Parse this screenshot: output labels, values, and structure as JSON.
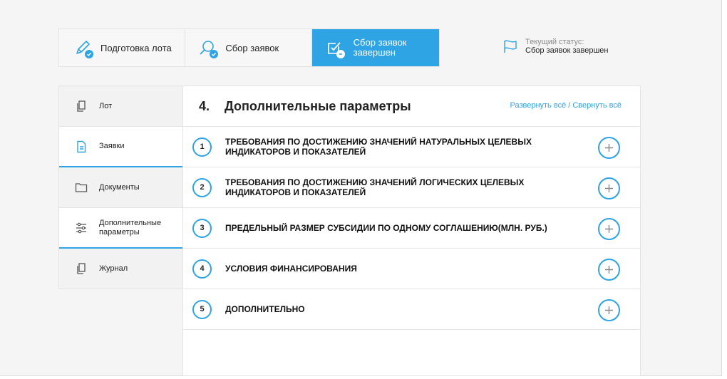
{
  "stepper": {
    "steps": [
      {
        "label": "Подготовка лота",
        "icon": "pencil-icon",
        "badge": "check-badge"
      },
      {
        "label": "Сбор заявок",
        "icon": "search-icon",
        "badge": "check-badge"
      },
      {
        "label_line1": "Сбор заявок",
        "label_line2": "завершен",
        "icon": "checkbox-icon",
        "badge": "minus-badge",
        "active": true
      }
    ]
  },
  "status": {
    "caption": "Текущий статус:",
    "value": "Сбор заявок завершен",
    "icon": "flag-icon"
  },
  "sidebar": {
    "items": [
      {
        "label": "Лот",
        "icon": "copy-icon"
      },
      {
        "label": "Заявки",
        "icon": "document-icon",
        "active": true
      },
      {
        "label": "Документы",
        "icon": "folder-icon"
      },
      {
        "label_line1": "Дополнительные",
        "label_line2": "параметры",
        "icon": "sliders-icon",
        "active": true
      },
      {
        "label": "Журнал",
        "icon": "copy-icon"
      }
    ]
  },
  "main": {
    "section_number": "4.",
    "title": "Дополнительные параметры",
    "expand_collapse": "Развернуть всё / Свернуть всё",
    "rows": [
      {
        "num": "1",
        "title_line1": "ТРЕБОВАНИЯ ПО ДОСТИЖЕНИЮ ЗНАЧЕНИЙ НАТУРАЛЬНЫХ ЦЕЛЕВЫХ",
        "title_line2": "ИНДИКАТОРОВ И ПОКАЗАТЕЛЕЙ"
      },
      {
        "num": "2",
        "title_line1": "ТРЕБОВАНИЯ ПО ДОСТИЖЕНИЮ ЗНАЧЕНИЙ ЛОГИЧЕСКИХ ЦЕЛЕВЫХ",
        "title_line2": "ИНДИКАТОРОВ И ПОКАЗАТЕЛЕЙ"
      },
      {
        "num": "3",
        "title_line1": "ПРЕДЕЛЬНЫЙ РАЗМЕР СУБСИДИИ ПО ОДНОМУ СОГЛАШЕНИЮ(МЛН. РУБ.)",
        "title_line2": ""
      },
      {
        "num": "4",
        "title_line1": "УСЛОВИЯ ФИНАНСИРОВАНИЯ",
        "title_line2": ""
      },
      {
        "num": "5",
        "title_line1": "ДОПОЛНИТЕЛЬНО",
        "title_line2": ""
      }
    ]
  },
  "colors": {
    "accent": "#2ea4e5",
    "background": "#f5f5f5",
    "text": "#222222"
  }
}
